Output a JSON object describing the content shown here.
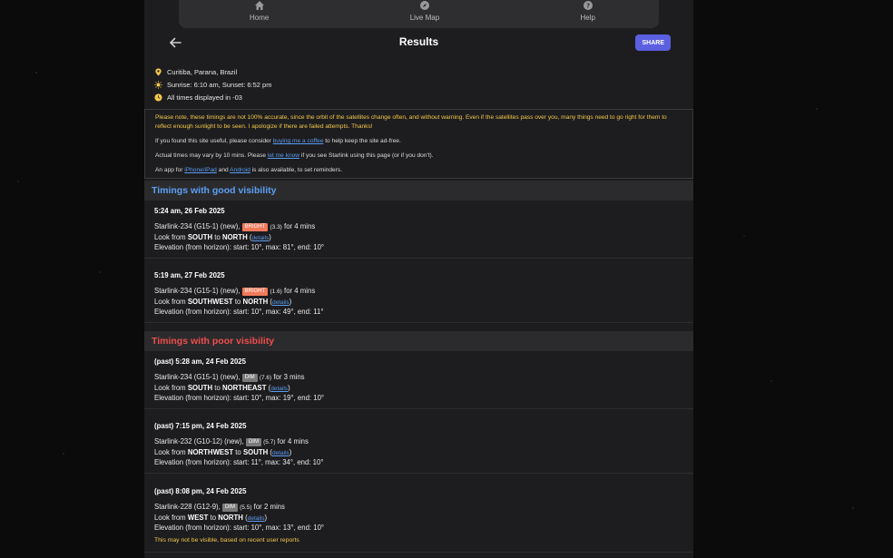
{
  "nav": {
    "items": [
      {
        "label": "Home",
        "icon": "home-icon"
      },
      {
        "label": "Live Map",
        "icon": "compass-icon"
      },
      {
        "label": "Help",
        "icon": "help-icon"
      }
    ]
  },
  "header": {
    "title": "Results",
    "share_label": "SHARE"
  },
  "meta": {
    "location": "Curitiba, Parana, Brazil",
    "sun": "Sunrise: 6:10 am, Sunset: 6:52 pm",
    "timezone": "All times displayed in -03"
  },
  "notice": {
    "warning": "Please note, these timings are not 100% accurate, since the orbit of the satellites change often, and without warning. Even if the satellites pass over you, many things need to go right for them to reflect enough sunlight to be seen. I apologize if there are failed attempts. Thanks!",
    "coffee_pre": "If you found this site useful, please consider ",
    "coffee_link": "buying me a coffee",
    "coffee_post": " to help keep the site ad-free.",
    "vary_pre": "Actual times may vary by 10 mins. Please ",
    "vary_link": "let me know",
    "vary_post": " if you see Starlink using this page (or if you don't).",
    "app_pre": "An app for ",
    "app_ios": "iPhone/iPad",
    "app_and": " and ",
    "app_android": "Android",
    "app_post": " is also available, to set reminders."
  },
  "sections": {
    "good_title": "Timings with good visibility",
    "poor_title": "Timings with poor visibility"
  },
  "passes": [
    {
      "when": "5:24 am, 26 Feb 2025",
      "sat": "Starlink-234 (G15-1) (new), ",
      "badge": "BRIGHT",
      "mag": "(3.3)",
      "dur": " for 4 mins",
      "from": "SOUTH",
      "to": "NORTH",
      "details": "details",
      "elev": "Elevation (from horizon): start: 10°, max: 81°, end: 10°"
    },
    {
      "when": "5:19 am, 27 Feb 2025",
      "sat": "Starlink-234 (G15-1) (new), ",
      "badge": "BRIGHT",
      "mag": "(1.6)",
      "dur": " for 4 mins",
      "from": "SOUTHWEST",
      "to": "NORTH",
      "details": "details",
      "elev": "Elevation (from horizon): start: 10°, max: 49°, end: 11°"
    },
    {
      "when": "(past) 5:28 am, 24 Feb 2025",
      "sat": "Starlink-234 (G15-1) (new), ",
      "badge": "DIM",
      "mag": "(7.6)",
      "dur": " for 3 mins",
      "from": "SOUTH",
      "to": "NORTHEAST",
      "details": "details",
      "elev": "Elevation (from horizon): start: 10°, max: 19°, end: 10°"
    },
    {
      "when": "(past) 7:15 pm, 24 Feb 2025",
      "sat": "Starlink-232 (G10-12) (new), ",
      "badge": "DIM",
      "mag": "(5.7)",
      "dur": " for 4 mins",
      "from": "NORTHWEST",
      "to": "SOUTH",
      "details": "details",
      "elev": "Elevation (from horizon): start: 11°, max: 34°, end: 10°"
    },
    {
      "when": "(past) 8:08 pm, 24 Feb 2025",
      "sat": "Starlink-228 (G12-9), ",
      "badge": "DIM",
      "mag": "(5.5)",
      "dur": " for 2 mins",
      "from": "WEST",
      "to": "NORTH",
      "details": "details",
      "elev": "Elevation (from horizon): start: 10°, max: 13°, end: 10°",
      "note": "This may not be visible, based on recent user reports"
    }
  ],
  "labels": {
    "look_from": "Look from ",
    "to": " to ",
    "paren_open": " (",
    "paren_close": ")"
  },
  "colors": {
    "accent": "#5b5fe0",
    "good": "#5ba0f5",
    "poor": "#ef4d4d",
    "warn": "#f5c84b",
    "bright": "#f07a5a"
  }
}
